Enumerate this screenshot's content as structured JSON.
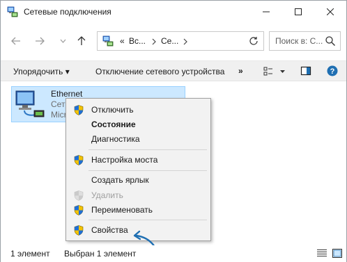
{
  "window": {
    "title": "Сетевые подключения"
  },
  "nav": {
    "back_icon": "arrow-left-icon",
    "forward_icon": "arrow-right-icon",
    "recent_icon": "chevron-down-icon",
    "up_icon": "arrow-up-icon"
  },
  "address": {
    "overflow": "«",
    "segments": [
      "Вс...",
      "Се..."
    ]
  },
  "search": {
    "placeholder": "Поиск в: С..."
  },
  "commandbar": {
    "organize": "Упорядочить ▾",
    "disconnect": "Отключение сетевого устройства",
    "more": "»"
  },
  "item": {
    "name": "Ethernet",
    "line1": "Сеть",
    "line2": "Micr"
  },
  "context_menu": {
    "items": [
      {
        "label": "Отключить",
        "shield": true
      },
      {
        "label": "Состояние",
        "bold": true
      },
      {
        "label": "Диагностика"
      },
      {
        "label": "Настройка моста",
        "shield": true
      },
      {
        "label": "Создать ярлык"
      },
      {
        "label": "Удалить",
        "shield": true,
        "disabled": true
      },
      {
        "label": "Переименовать",
        "shield": true
      },
      {
        "label": "Свойства",
        "shield": true
      }
    ]
  },
  "statusbar": {
    "count": "1 элемент",
    "selected": "Выбран 1 элемент"
  },
  "colors": {
    "selection": "#cce8ff",
    "selection_border": "#99d1ff",
    "annotation_arrow": "#1f6fb2",
    "menu_bg": "#f2f2f2"
  }
}
